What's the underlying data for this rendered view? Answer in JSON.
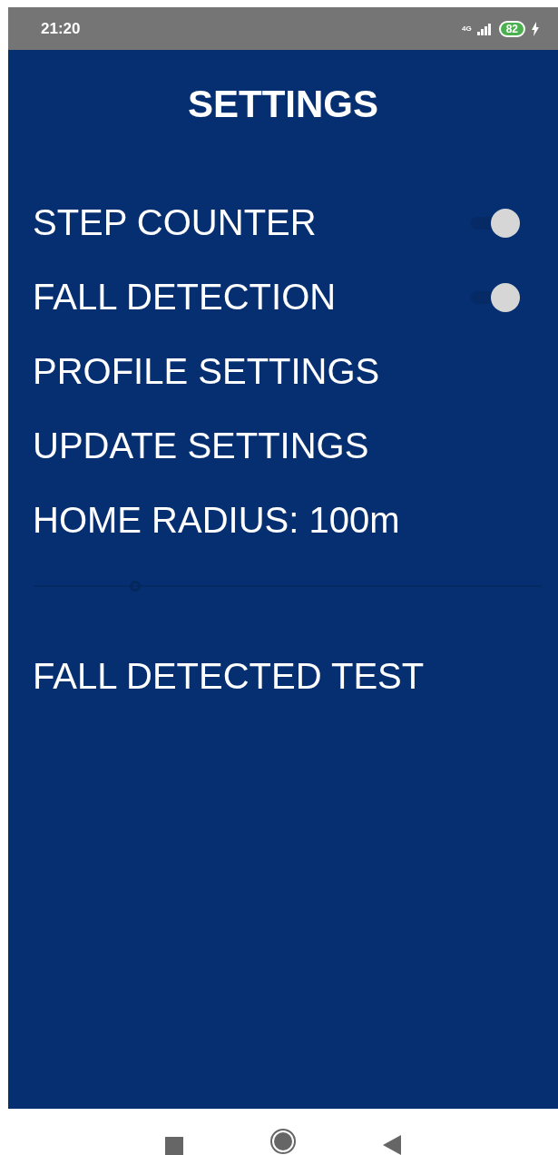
{
  "status_bar": {
    "time": "21:20",
    "network": "4G",
    "battery": "82"
  },
  "title": "SETTINGS",
  "items": [
    {
      "kind": "switch",
      "label": "STEP COUNTER",
      "on": true
    },
    {
      "kind": "switch",
      "label": "FALL DETECTION",
      "on": true
    },
    {
      "kind": "link",
      "label": "PROFILE SETTINGS"
    },
    {
      "kind": "link",
      "label": "UPDATE SETTINGS"
    },
    {
      "kind": "text",
      "label": "HOME RADIUS: 100m"
    },
    {
      "kind": "slider",
      "level": 0.2
    },
    {
      "kind": "link",
      "label": "FALL DETECTED TEST"
    }
  ]
}
